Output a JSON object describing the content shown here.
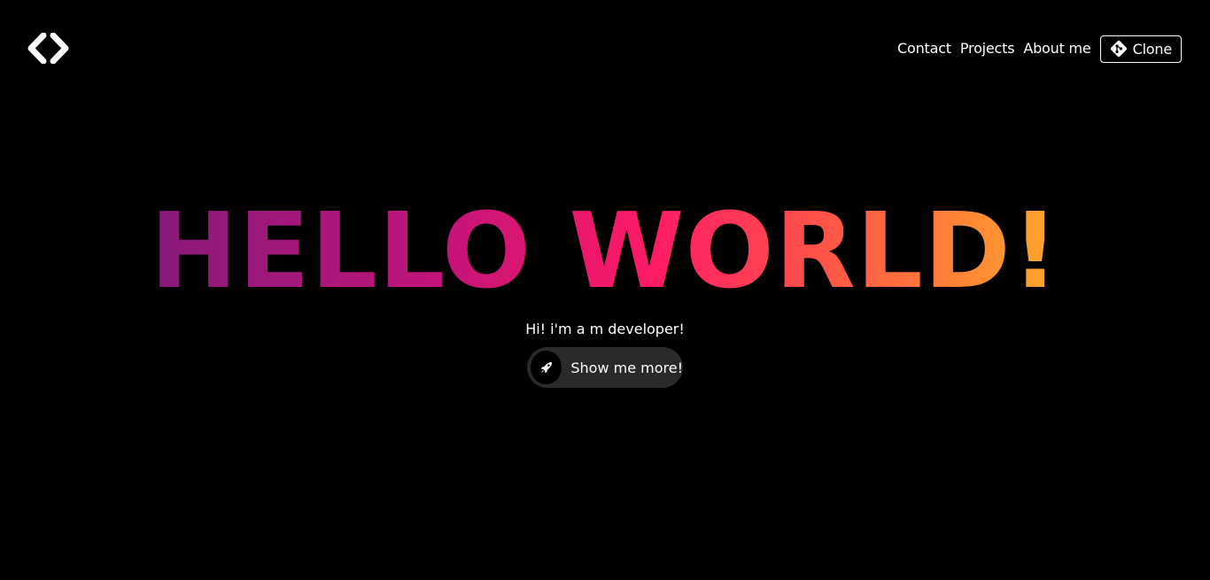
{
  "header": {
    "logo_icon": "code-brackets-icon",
    "nav": [
      {
        "label": "Contact"
      },
      {
        "label": "Projects"
      },
      {
        "label": "About me"
      }
    ],
    "clone_button": {
      "label": "Clone",
      "icon": "git-icon"
    }
  },
  "hero": {
    "title": "HELLO WORLD!",
    "subtitle": "Hi! i'm a m developer!",
    "cta": {
      "label": "Show me more!",
      "icon": "rocket-icon"
    }
  },
  "colors": {
    "background": "#000000",
    "text": "#ffffff",
    "gradient": [
      "#861a7a",
      "#c2147a",
      "#ff1a66",
      "#ff5a45",
      "#ffa82a"
    ],
    "button_background": "#2a2a2a"
  }
}
